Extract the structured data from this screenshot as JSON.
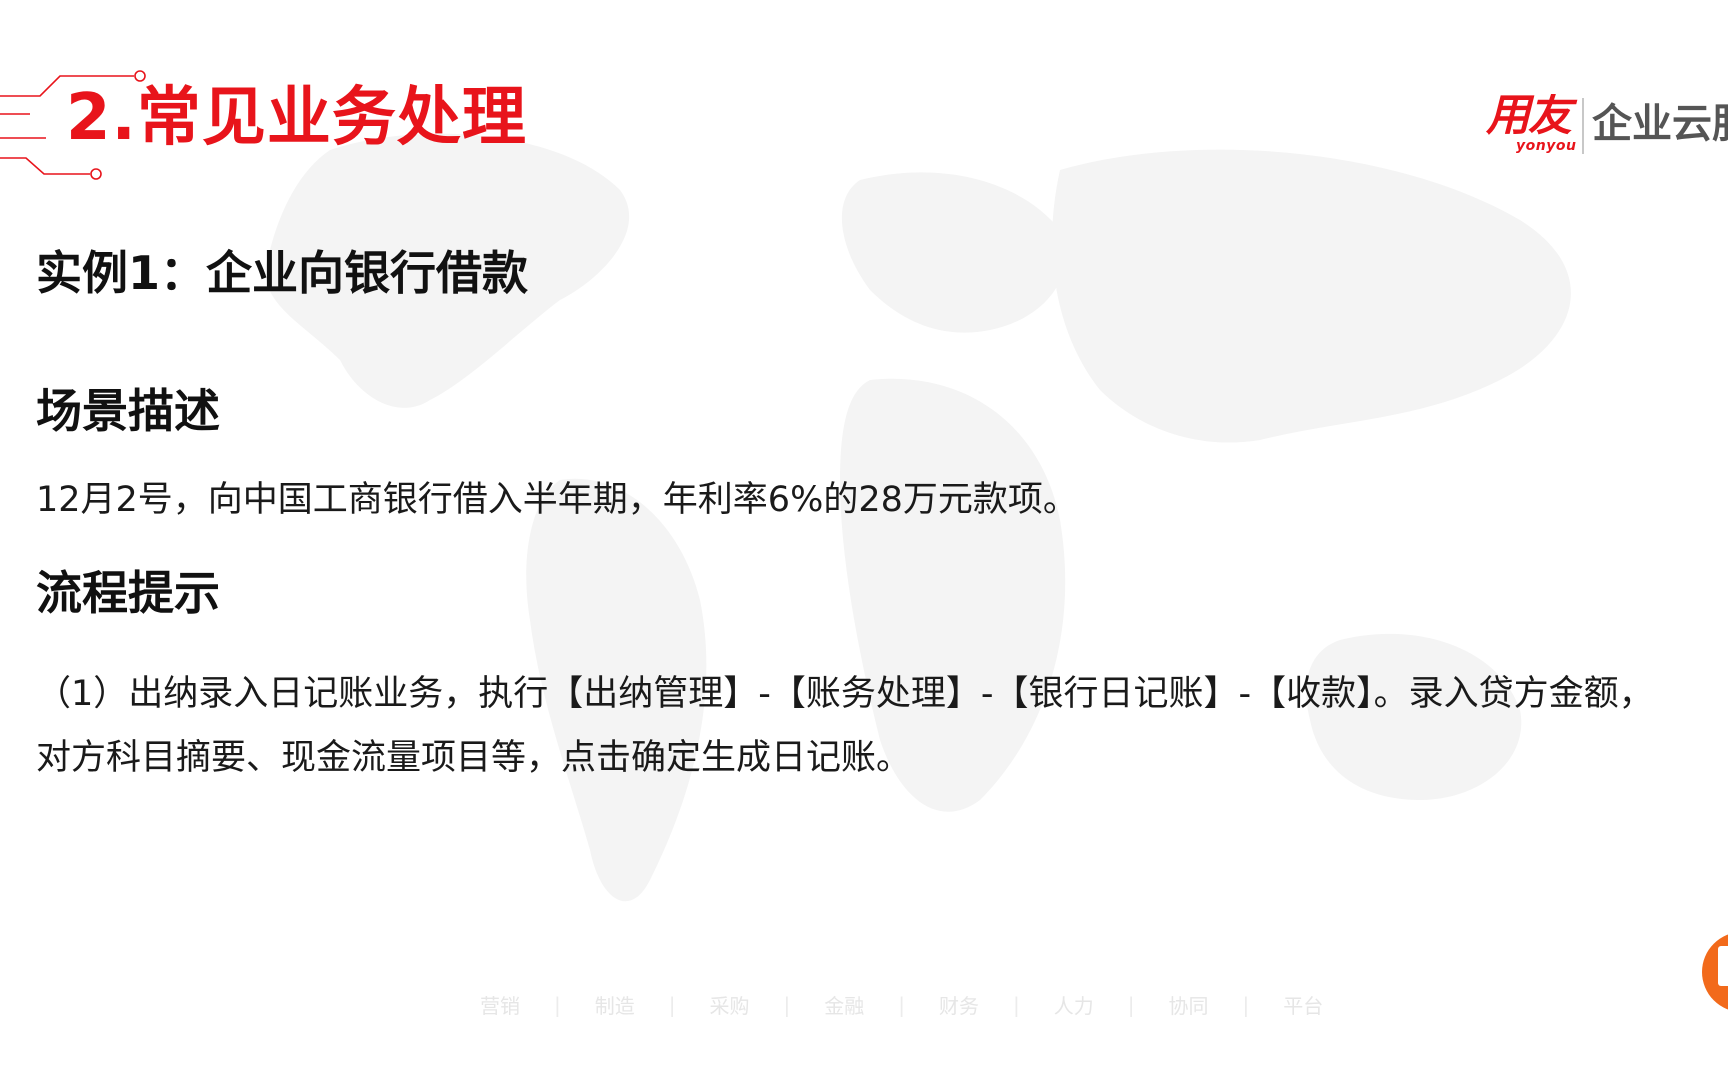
{
  "section_title": "2.常见业务处理",
  "logo": {
    "mark": "用友",
    "sub": "yonyou",
    "text": "企业云服务"
  },
  "example_title": "实例1：企业向银行借款",
  "scene": {
    "heading": "场景描述",
    "description": "12月2号，向中国工商银行借入半年期，年利率6%的28万元款项。"
  },
  "process": {
    "heading": "流程提示",
    "step_line_1": "（1）出纳录入日记账业务，执行【出纳管理】-【账务处理】-【银行日记账】-【收款】。录入贷方金额，",
    "step_line_2": "对方科目摘要、现金流量项目等，点击确定生成日记账。"
  },
  "footer_nav": [
    "营销",
    "制造",
    "采购",
    "金融",
    "财务",
    "人力",
    "协同",
    "平台"
  ],
  "colors": {
    "accent": "#e8141b",
    "badge": "#f26a1b"
  }
}
